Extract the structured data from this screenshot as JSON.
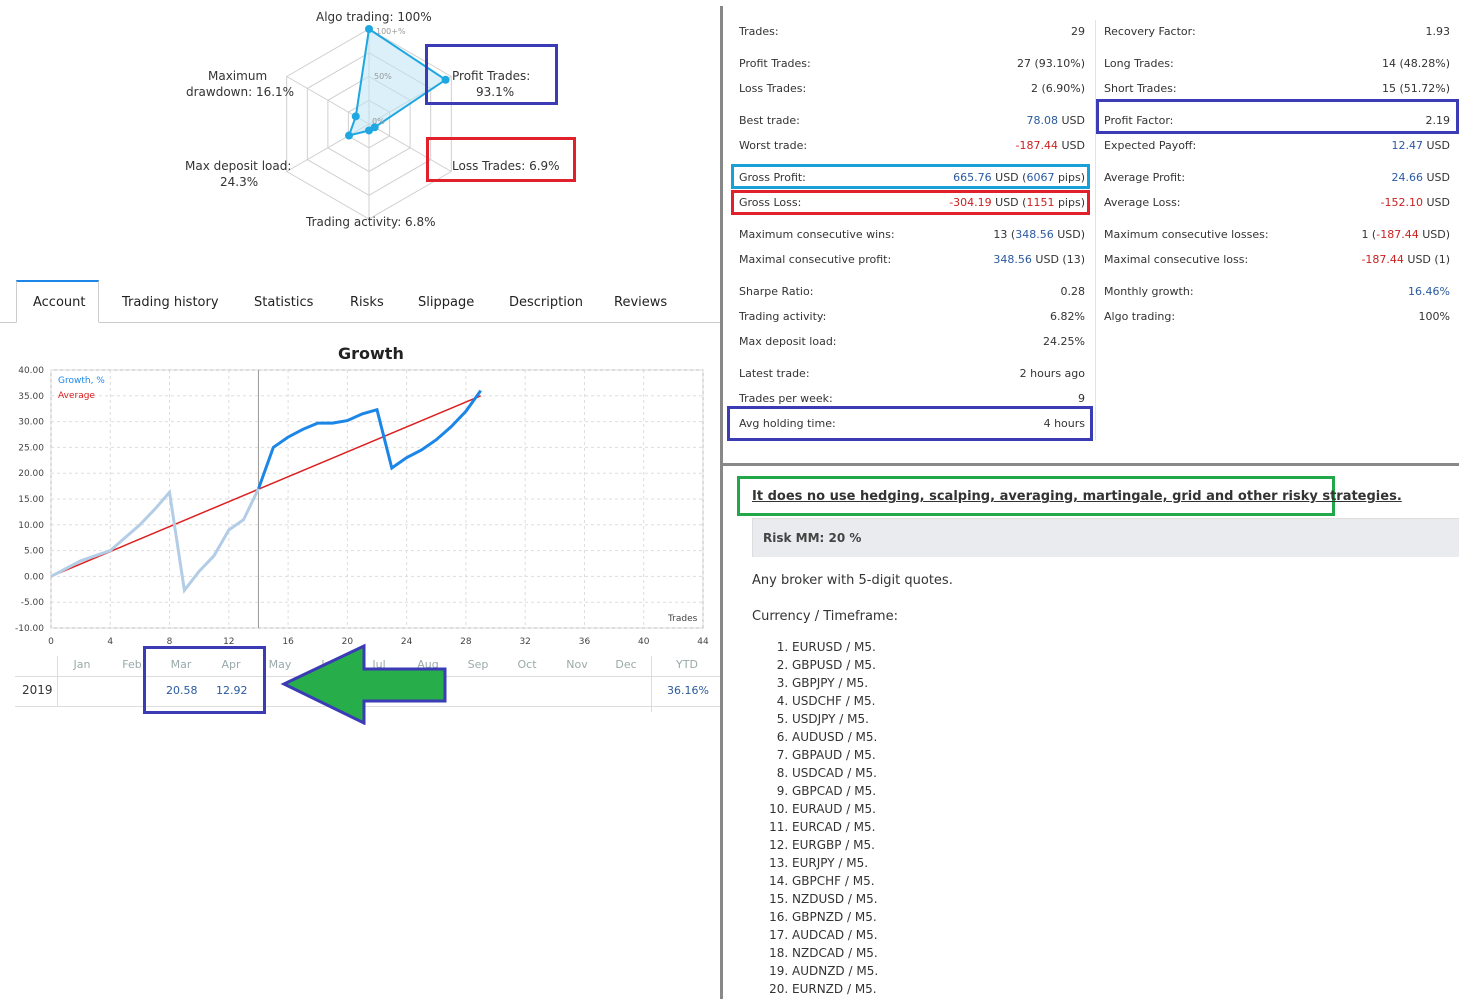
{
  "radar": {
    "algo_trading": "Algo trading: 100%",
    "profit_trades_l1": "Profit Trades:",
    "profit_trades_l2": "93.1%",
    "loss_trades": "Loss Trades: 6.9%",
    "max_drawdown_l1": "Maximum",
    "max_drawdown_l2": "drawdown: 16.1%",
    "max_deposit_load_l1": "Max deposit load:",
    "max_deposit_load_l2": "24.3%",
    "trading_activity": "Trading activity: 6.8%",
    "scale_100": "100+%",
    "scale_50": "50%",
    "scale_0": "0%",
    "values": {
      "algo": 1.0,
      "profit": 0.931,
      "loss": 0.069,
      "activity": 0.068,
      "deposit": 0.243,
      "drawdown": 0.161
    }
  },
  "tabs": [
    "Account",
    "Trading history",
    "Statistics",
    "Risks",
    "Slippage",
    "Description",
    "Reviews"
  ],
  "growth": {
    "title": "Growth",
    "legend_growth": "Growth, %",
    "legend_average": "Average",
    "xaxis_label": "Trades"
  },
  "chart_data": {
    "type": "line",
    "title": "Growth",
    "xlabel": "Trades",
    "ylabel": "",
    "xlim": [
      0,
      44
    ],
    "ylim": [
      -10,
      40
    ],
    "x_ticks": [
      "0",
      "4",
      "8",
      "12",
      "16",
      "20",
      "24",
      "28",
      "32",
      "36",
      "40",
      "44"
    ],
    "y_ticks": [
      "40.00",
      "35.00",
      "30.00",
      "25.00",
      "20.00",
      "15.00",
      "10.00",
      "5.00",
      "0.00",
      "-5.00",
      "-10.00"
    ],
    "series": [
      {
        "name": "Growth, %",
        "color": "#1c86e8",
        "x": [
          0,
          2,
          4,
          6,
          7,
          8,
          9,
          10,
          11,
          12,
          13,
          14,
          15,
          16,
          17,
          18,
          19,
          20,
          21,
          22,
          23,
          24,
          25,
          26,
          27,
          28,
          29
        ],
        "y": [
          0,
          3,
          5,
          10,
          13,
          16.3,
          -2.7,
          1,
          4,
          9,
          11,
          17,
          25,
          27,
          28.5,
          29.7,
          29.7,
          30.2,
          31.5,
          32.3,
          21,
          23,
          24.5,
          26.5,
          29,
          32,
          36
        ]
      },
      {
        "name": "Average",
        "color": "#dd2020",
        "x": [
          0,
          29
        ],
        "y": [
          0,
          35
        ]
      }
    ],
    "highlight_until_x": 14
  },
  "months": {
    "headers": [
      "Jan",
      "Feb",
      "Mar",
      "Apr",
      "May",
      "Jun",
      "Jul",
      "Aug",
      "Sep",
      "Oct",
      "Nov",
      "Dec",
      "YTD"
    ],
    "year": "2019",
    "mar": "20.58",
    "apr": "12.92",
    "ytd": "36.16%"
  },
  "stats_left": [
    {
      "label": "Trades:",
      "value": "29"
    },
    {
      "label": "Profit Trades:",
      "value": "27 (93.10%)"
    },
    {
      "label": "Loss Trades:",
      "value": "2 (6.90%)"
    },
    {
      "label": "Best trade:",
      "value": "78.08",
      "unit": " USD"
    },
    {
      "label": "Worst trade:",
      "value": "-187.44",
      "unit": " USD"
    },
    {
      "label": "Gross Profit:",
      "value": "665.76",
      "unit": " USD (",
      "extra": "6067",
      "tail": " pips)"
    },
    {
      "label": "Gross Loss:",
      "value": "-304.19",
      "unit": " USD (",
      "extra": "1151",
      "tail": " pips)"
    },
    {
      "label": "Maximum consecutive wins:",
      "value": "13 (",
      "extra": "348.56",
      "tail": " USD)"
    },
    {
      "label": "Maximal consecutive profit:",
      "value": "348.56",
      "unit": " USD (13)"
    },
    {
      "label": "Sharpe Ratio:",
      "value": "0.28"
    },
    {
      "label": "Trading activity:",
      "value": "6.82%"
    },
    {
      "label": "Max deposit load:",
      "value": "24.25%"
    },
    {
      "label": "Latest trade:",
      "value": "2 hours ago"
    },
    {
      "label": "Trades per week:",
      "value": "9"
    },
    {
      "label": "Avg holding time:",
      "value": "4 hours"
    }
  ],
  "stats_right": [
    {
      "label": "Recovery Factor:",
      "value": "1.93"
    },
    {
      "label": "Long Trades:",
      "value": "14 (48.28%)"
    },
    {
      "label": "Short Trades:",
      "value": "15 (51.72%)"
    },
    {
      "label": "Profit Factor:",
      "value": "2.19"
    },
    {
      "label": "Expected Payoff:",
      "value": "12.47",
      "unit": " USD"
    },
    {
      "label": "Average Profit:",
      "value": "24.66",
      "unit": " USD"
    },
    {
      "label": "Average Loss:",
      "value": "-152.10",
      "unit": " USD"
    },
    {
      "label": "Maximum consecutive losses:",
      "value": "1 (",
      "extra": "-187.44",
      "tail": " USD)"
    },
    {
      "label": "Maximal consecutive loss:",
      "value": "-187.44",
      "unit": " USD (1)"
    },
    {
      "label": "Monthly growth:",
      "value": "16.46%"
    },
    {
      "label": "Algo trading:",
      "value": "100%"
    }
  ],
  "description": {
    "headline": "It does no use hedging, scalping, averaging, martingale, grid and other risky strategies.",
    "risk": "Risk MM: 20 %",
    "broker": "Any broker with 5-digit quotes.",
    "currency_title": "Currency / Timeframe:",
    "pairs": [
      "EURUSD / M5.",
      "GBPUSD / M5.",
      "GBPJPY / M5.",
      "USDCHF / M5.",
      "USDJPY / M5.",
      "AUDUSD / M5.",
      "GBPAUD / M5.",
      "USDCAD / M5.",
      "GBPCAD / M5.",
      "EURAUD / M5.",
      "EURCAD / M5.",
      "EURGBP / M5.",
      "EURJPY / M5.",
      "GBPCHF / M5.",
      "NZDUSD / M5.",
      "GBPNZD / M5.",
      "AUDCAD / M5.",
      "NZDCAD / M5.",
      "AUDNZD / M5.",
      "EURNZD / M5."
    ]
  },
  "colors": {
    "blue_box": "#3b3bb5",
    "red_box": "#e0202b",
    "cyan_box": "#1aa0d8",
    "green_box": "#22a84a",
    "arrow": "#27ae4a"
  }
}
